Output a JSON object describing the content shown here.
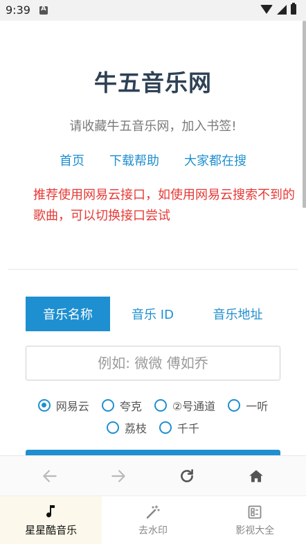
{
  "status_bar": {
    "time": "9:39"
  },
  "site": {
    "title": "牛五音乐网",
    "subtitle": "请收藏牛五音乐网，加入书签!",
    "nav": [
      {
        "label": "首页"
      },
      {
        "label": "下载帮助"
      },
      {
        "label": "大家都在搜"
      }
    ],
    "notice": "推荐使用网易云接口，如使用网易云搜索不到的歌曲，可以切换接口尝试"
  },
  "search": {
    "tabs": [
      {
        "label": "音乐名称",
        "active": true
      },
      {
        "label": "音乐 ID",
        "active": false
      },
      {
        "label": "音乐地址",
        "active": false
      }
    ],
    "input_value": "",
    "placeholder": "例如: 微微 傅如乔",
    "sources": [
      {
        "label": "网易云",
        "checked": true
      },
      {
        "label": "夸克",
        "checked": false
      },
      {
        "label": "②号通道",
        "checked": false
      },
      {
        "label": "一听",
        "checked": false
      },
      {
        "label": "荔枝",
        "checked": false
      },
      {
        "label": "千千",
        "checked": false
      }
    ]
  },
  "browser_toolbar": {
    "icons": [
      "back-arrow-icon",
      "forward-arrow-icon",
      "refresh-icon",
      "home-icon"
    ]
  },
  "bottom_nav": {
    "items": [
      {
        "label": "星星酷音乐",
        "icon": "music-note-icon",
        "active": true
      },
      {
        "label": "去水印",
        "icon": "magic-wand-icon",
        "active": false
      },
      {
        "label": "影视大全",
        "icon": "list-board-icon",
        "active": false
      }
    ]
  },
  "colors": {
    "accent": "#1e8fd0",
    "notice": "#e53935",
    "title": "#2f4155"
  }
}
